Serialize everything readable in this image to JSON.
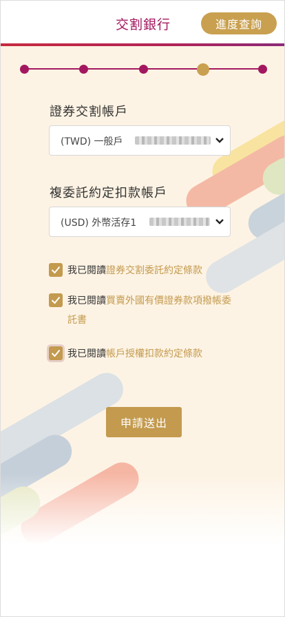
{
  "header": {
    "title": "交割銀行",
    "progress_button": "進度查詢"
  },
  "steps": {
    "total": 5,
    "current": 4
  },
  "form": {
    "securities_account_label": "證券交割帳戶",
    "securities_account_value": "(TWD) 一般戶",
    "debit_account_label": "複委託約定扣款帳戶",
    "debit_account_value": "(USD) 外幣活存1"
  },
  "agreements": [
    {
      "prefix": "我已閱讀",
      "link": "證券交割委託約定條款",
      "checked": true
    },
    {
      "prefix": "我已閱讀",
      "link": "買賣外國有價證券款項撥帳委託書",
      "checked": true
    },
    {
      "prefix": "我已閱讀",
      "link": "帳戶授權扣款約定條款",
      "checked": true
    }
  ],
  "submit_label": "申請送出",
  "colors": {
    "brand": "#a3175f",
    "gold": "#c39a4e",
    "background": "#fdf3e4"
  }
}
